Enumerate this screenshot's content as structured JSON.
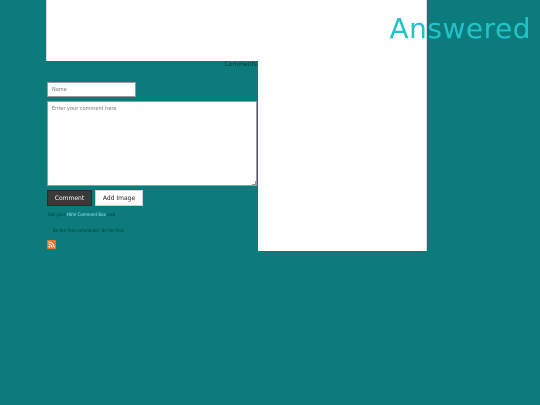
{
  "header": {
    "title": "Answered"
  },
  "comments": {
    "link_label": "Comments",
    "name_placeholder": "Name",
    "comment_placeholder": "Enter your comment here",
    "submit_label": "Comment",
    "add_image_label": "Add Image",
    "footer_prefix": "Get your",
    "footer_link": "Html Comment Box",
    "footer_suffix": "now",
    "footer_note": "Be the first commenter. Be the first."
  },
  "icons": {
    "rss": "rss-icon"
  },
  "colors": {
    "background": "#0b7b7b",
    "accent": "#22c3c8",
    "rss": "#e8742c"
  }
}
